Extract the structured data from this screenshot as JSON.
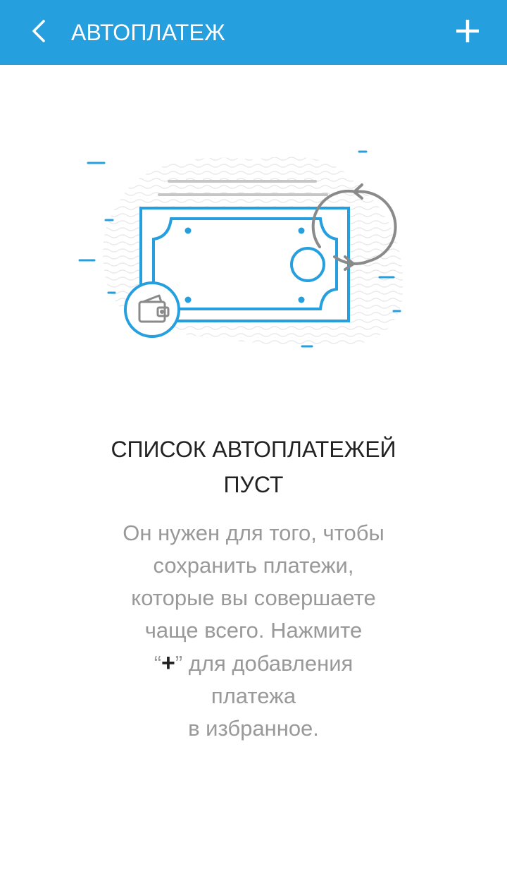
{
  "app_bar": {
    "title": "АВТОПЛАТЕЖ",
    "background_color": "#259fde",
    "back_icon": "chevron-left-icon",
    "add_icon": "plus-icon"
  },
  "illustration": {
    "icon": "banknote-with-wallet-and-refresh-icon",
    "accent_color": "#259fde",
    "secondary_color": "#8a8a8a"
  },
  "empty_state": {
    "title_line1": "СПИСОК АВТОПЛАТЕЖЕЙ",
    "title_line2": "ПУСТ",
    "description": {
      "line1": "Он нужен для того, чтобы",
      "line2": "сохранить платежи,",
      "line3": "которые вы совершаете",
      "line4": "чаще всего.  Нажмите",
      "line5_open_quote": "“",
      "line5_plus": "+",
      "line5_rest": "” для добавления",
      "line6": "платежа",
      "line7": "в избранное."
    }
  }
}
